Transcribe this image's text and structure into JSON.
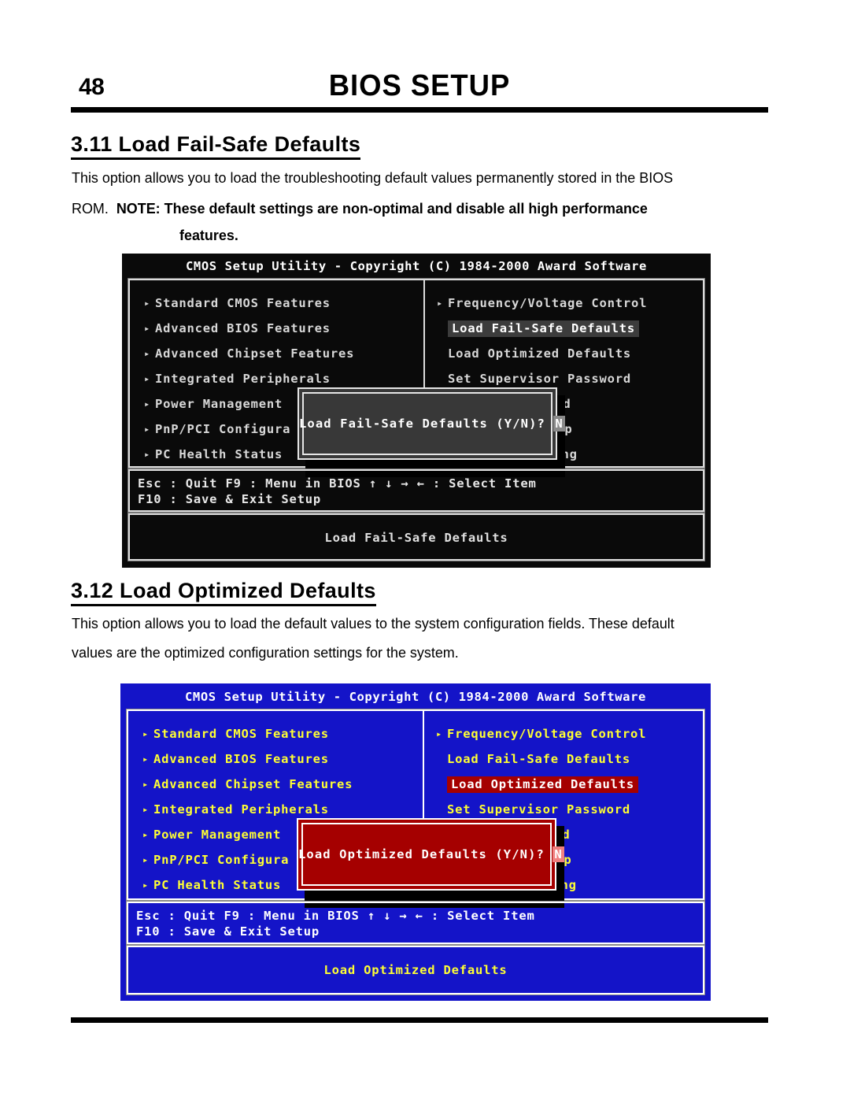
{
  "page": {
    "number": "48",
    "title": "BIOS SETUP"
  },
  "sections": [
    {
      "heading": "3.11  Load Fail-Safe Defaults",
      "paragraph_lines": [
        "This option allows you to load the troubleshooting default values permanently stored in the BIOS",
        "ROM.  NOTE: These default settings are non-optimal and disable all high performance",
        "features."
      ]
    },
    {
      "heading": "3.12  Load Optimized Defaults",
      "paragraph_lines": [
        "This option allows you to load the default values to the system configuration fields.  These default",
        "values are the optimized configuration settings for the system."
      ]
    }
  ],
  "bios_screens": [
    {
      "id": "fail-safe",
      "theme": "gray",
      "title": "CMOS Setup Utility - Copyright (C) 1984-2000 Award Software",
      "left_menu": [
        "Standard CMOS Features",
        "Advanced BIOS Features",
        "Advanced Chipset Features",
        "Integrated Peripherals",
        "Power Management",
        "PnP/PCI Configura",
        "PC Health Status"
      ],
      "right_menu": [
        "Frequency/Voltage Control",
        "Load Fail-Safe Defaults",
        "Load Optimized Defaults",
        "Set Supervisor Password",
        "word",
        "etup",
        "Saving"
      ],
      "selected_right_index": 1,
      "help_lines": [
        "Esc : Quit      F9 : Menu in BIOS        ↑ ↓ → ←   : Select Item",
        "F10 : Save & Exit Setup"
      ],
      "status": "Load Fail-Safe Defaults",
      "dialog": {
        "prompt": "Load Fail-Safe Defaults (Y/N)?",
        "cursor": "N"
      },
      "colors": {
        "background": "#0a0a0a",
        "text": "#d8d8d8",
        "highlight_bg": "#3c3c3c",
        "dialog_bg": "#383838",
        "border": "#e6e6e6"
      }
    },
    {
      "id": "optimized",
      "theme": "blue",
      "title": "CMOS Setup Utility - Copyright (C) 1984-2000 Award Software",
      "left_menu": [
        "Standard CMOS Features",
        "Advanced BIOS Features",
        "Advanced Chipset Features",
        "Integrated Peripherals",
        "Power Management",
        "PnP/PCI Configura",
        "PC Health Status"
      ],
      "right_menu": [
        "Frequency/Voltage Control",
        "Load Fail-Safe Defaults",
        "Load Optimized Defaults",
        "Set Supervisor Password",
        "word",
        "etup",
        "Saving"
      ],
      "selected_right_index": 2,
      "help_lines": [
        "Esc : Quit      F9 : Menu in BIOS        ↑ ↓ → ←   : Select Item",
        "F10 : Save & Exit Setup"
      ],
      "status": "Load Optimized Defaults",
      "dialog": {
        "prompt": "Load Optimized Defaults (Y/N)?",
        "cursor": "N"
      },
      "colors": {
        "background": "#1414c8",
        "text": "#ffff33",
        "highlight_bg": "#a50000",
        "dialog_bg": "#a50000",
        "border": "#ffffff"
      }
    }
  ],
  "icons": {
    "submenu_arrow": "▸"
  }
}
